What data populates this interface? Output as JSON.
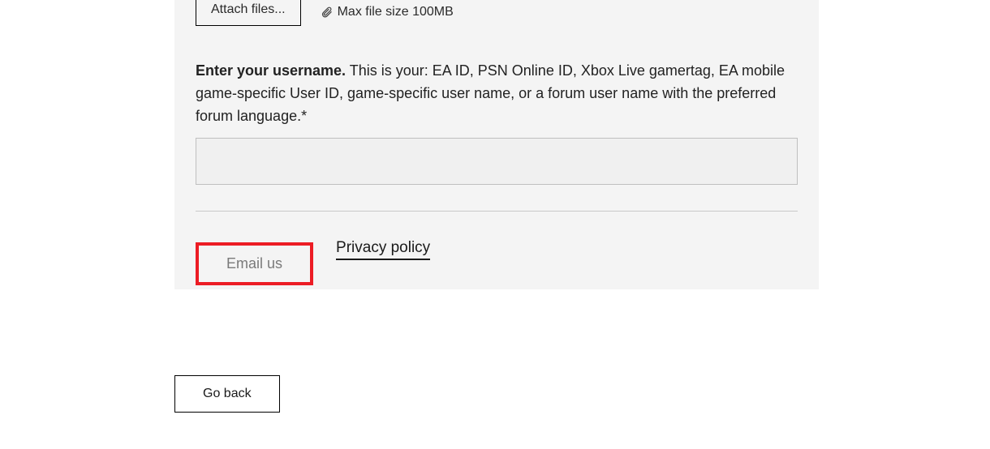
{
  "attach": {
    "button_label": "Attach files...",
    "max_file_text": "Max file size 100MB"
  },
  "username": {
    "label_bold": "Enter your username.",
    "label_rest": " This is your: EA ID, PSN Online ID, Xbox Live gamertag, EA mobile game-specific User ID, game-specific user name, or a forum user name with the preferred forum language.*",
    "value": ""
  },
  "actions": {
    "email_us_label": "Email us",
    "privacy_label": "Privacy policy",
    "go_back_label": "Go back"
  }
}
